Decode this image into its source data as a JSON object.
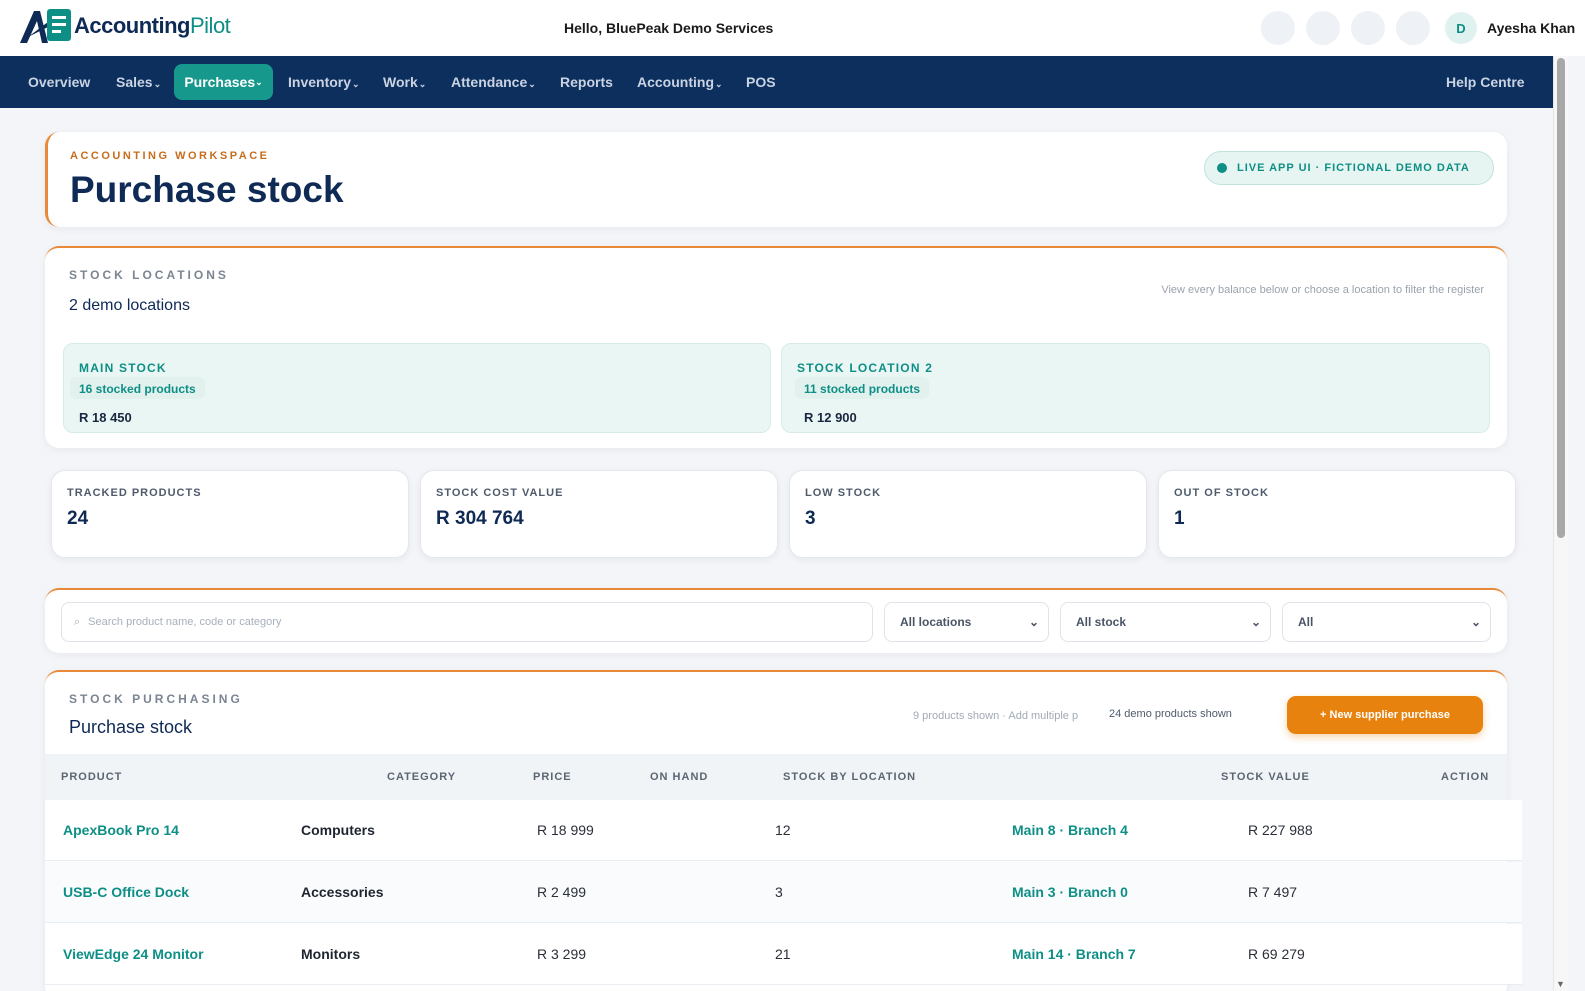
{
  "brand": {
    "name_main": "Accounting",
    "name_accent": "Pilot"
  },
  "greeting": "Hello, BluePeak Demo Services",
  "user": {
    "initial": "D",
    "name": "Ayesha Khan"
  },
  "nav": {
    "items": [
      {
        "label": "Overview",
        "caret": ""
      },
      {
        "label": "Sales",
        "caret": "⌄"
      },
      {
        "label": "Purchases",
        "caret": "⌄"
      },
      {
        "label": "Inventory",
        "caret": "⌄"
      },
      {
        "label": "Work",
        "caret": "⌄"
      },
      {
        "label": "Attendance",
        "caret": "⌄"
      },
      {
        "label": "Reports",
        "caret": ""
      },
      {
        "label": "Accounting",
        "caret": "⌄"
      },
      {
        "label": "POS",
        "caret": ""
      }
    ],
    "help": "Help Centre"
  },
  "header": {
    "eyebrow": "ACCOUNTING WORKSPACE",
    "title": "Purchase stock",
    "badge": "LIVE APP UI · FICTIONAL DEMO DATA"
  },
  "locations": {
    "eyebrow": "STOCK LOCATIONS",
    "count": "2 demo locations",
    "hint": "View every balance below or choose a location to filter the register",
    "items": [
      {
        "name": "MAIN STOCK",
        "products": "16 stocked products",
        "value": "R 18 450"
      },
      {
        "name": "STOCK LOCATION 2",
        "products": "11 stocked products",
        "value": "R 12 900"
      }
    ]
  },
  "stats": [
    {
      "label": "TRACKED PRODUCTS",
      "value": "24"
    },
    {
      "label": "STOCK COST VALUE",
      "value": "R 304 764"
    },
    {
      "label": "LOW STOCK",
      "value": "3"
    },
    {
      "label": "OUT OF STOCK",
      "value": "1"
    }
  ],
  "filters": {
    "search_placeholder": "Search product name, code or category",
    "location": "All locations",
    "stock": "All stock",
    "category": "All"
  },
  "table": {
    "eyebrow": "STOCK PURCHASING",
    "title": "Purchase stock",
    "shown_overlap": "9 products shown · Add multiple p",
    "shown": "24 demo products shown",
    "new_button": "+ New supplier purchase",
    "columns": [
      "PRODUCT",
      "CATEGORY",
      "PRICE",
      "ON HAND",
      "STOCK BY LOCATION",
      "STOCK VALUE",
      "ACTION"
    ],
    "rows": [
      {
        "product": "ApexBook Pro 14",
        "category": "Computers",
        "price": "R 18 999",
        "on_hand": "12",
        "by_location": "Main 8 · Branch 4",
        "value": "R 227 988"
      },
      {
        "product": "USB-C Office Dock",
        "category": "Accessories",
        "price": "R 2 499",
        "on_hand": "3",
        "by_location": "Main 3 · Branch 0",
        "value": "R 7 497"
      },
      {
        "product": "ViewEdge 24 Monitor",
        "category": "Monitors",
        "price": "R 3 299",
        "on_hand": "21",
        "by_location": "Main 14 · Branch 7",
        "value": "R 69 279"
      }
    ]
  },
  "colors": {
    "navy": "#0d2f5e",
    "teal": "#16988d",
    "orange": "#e8820e"
  },
  "icons": [
    "logo-mark-icon",
    "search-icon",
    "chevron-down-icon",
    "status-dot-icon"
  ]
}
